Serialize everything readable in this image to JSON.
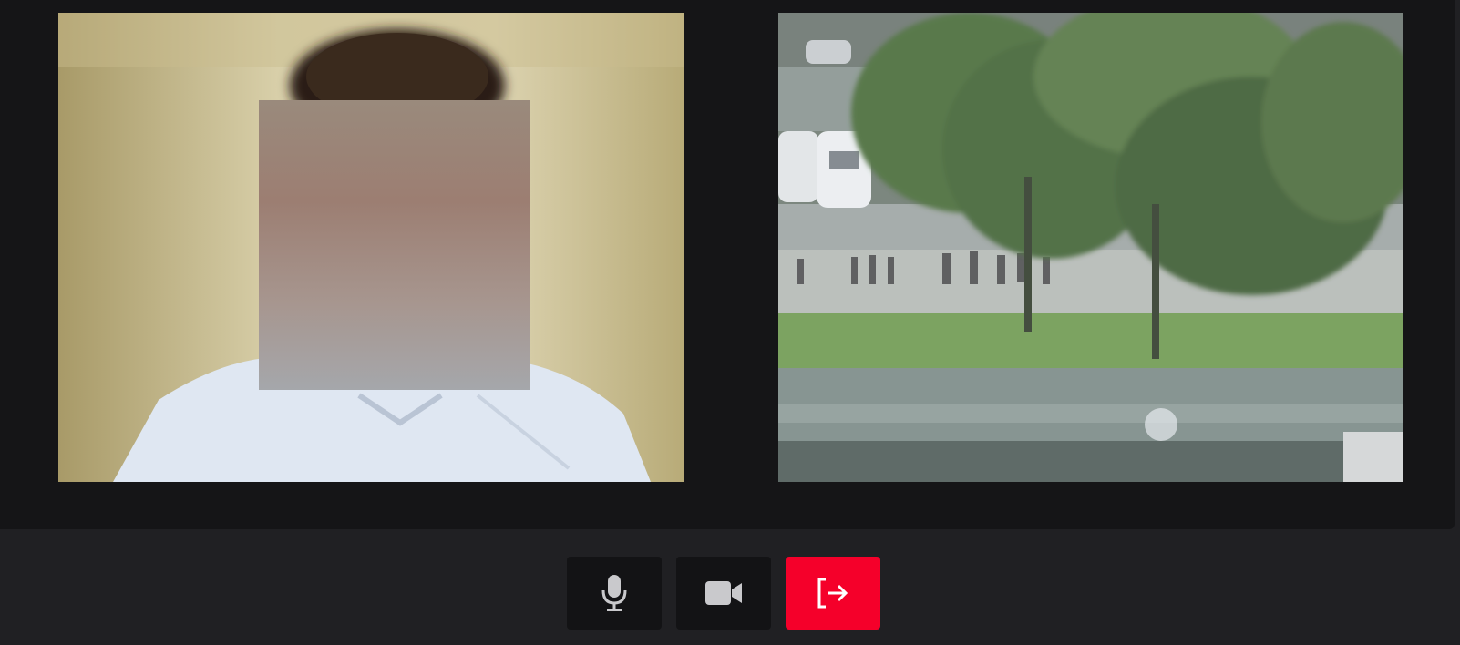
{
  "call": {
    "participants": [
      {
        "role": "local-camera",
        "face_blurred": true
      },
      {
        "role": "remote-camera",
        "face_blurred": false
      }
    ]
  },
  "controls": [
    {
      "id": "microphone",
      "icon": "microphone-icon",
      "state": "on"
    },
    {
      "id": "camera",
      "icon": "video-camera-icon",
      "state": "on"
    },
    {
      "id": "leave",
      "icon": "leave-call-icon"
    }
  ],
  "colors": {
    "page_background": "#202023",
    "video_area_background": "#151517",
    "control_button_background": "#131315",
    "leave_button_background": "#f5002a",
    "icon_color": "#c9c9cc",
    "leave_icon_color": "#ffffff"
  }
}
